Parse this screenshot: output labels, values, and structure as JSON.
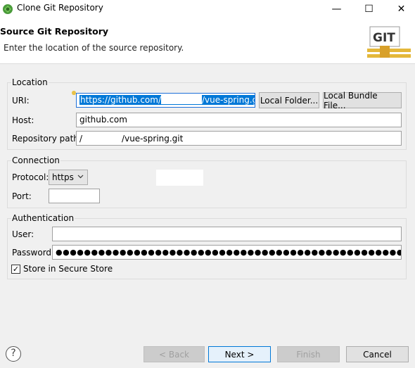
{
  "window": {
    "title": "Clone Git Repository",
    "minimize": "—",
    "maximize": "☐",
    "close": "✕"
  },
  "banner": {
    "title": "Source Git Repository",
    "description": "Enter the location of the source repository.",
    "logo_text": "GIT"
  },
  "location": {
    "title": "Location",
    "uri_label": "URI:",
    "uri_prefix": "https://github.com/",
    "uri_suffix": "/vue-spring.git",
    "local_folder_button": "Local Folder...",
    "local_bundle_button": "Local Bundle File...",
    "host_label": "Host:",
    "host_value": "github.com",
    "repo_path_label": "Repository path:",
    "repo_path_prefix": "/",
    "repo_path_suffix": "/vue-spring.git"
  },
  "connection": {
    "title": "Connection",
    "protocol_label": "Protocol:",
    "protocol_value": "https",
    "port_label": "Port:",
    "port_value": ""
  },
  "authentication": {
    "title": "Authentication",
    "user_label": "User:",
    "user_value": "",
    "password_label": "Password:",
    "password_mask": "●●●●●●●●●●●●●●●●●●●●●●●●●●●●●●●●●●●●●●●●●●●●●●●●●●●●●●●●",
    "store_label": "Store in Secure Store",
    "store_checked": "✓"
  },
  "footer": {
    "help": "?",
    "back": "< Back",
    "next": "Next >",
    "finish": "Finish",
    "cancel": "Cancel"
  },
  "colors": {
    "selection": "#0078d7",
    "focus_border": "#1e6fd9",
    "background": "#f0f0f0"
  }
}
